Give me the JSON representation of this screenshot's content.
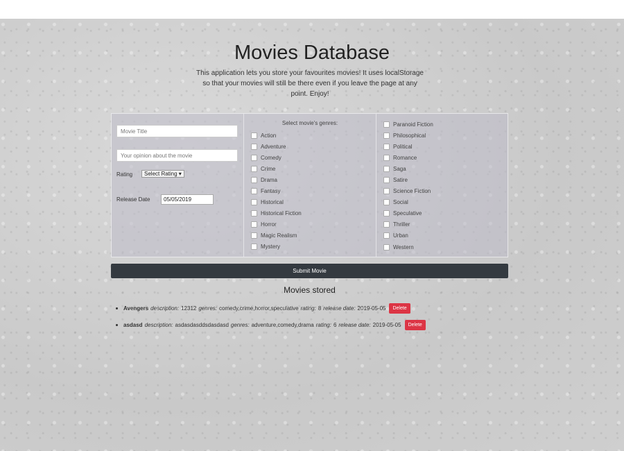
{
  "header": {
    "title": "Movies Database",
    "intro": "This application lets you store your favourites movies! It uses localStorage so that your movies will still be there even if you leave the page at any point. Enjoy!"
  },
  "form": {
    "title_placeholder": "Movie Title",
    "opinion_placeholder": "Your opinion about the movie",
    "rating_label": "Rating",
    "rating_select_value": "Select Rating ▾",
    "release_date_label": "Release Date",
    "release_date_value": "05/05/2019",
    "genres_heading": "Select movie's genres:",
    "genres_col1": [
      "Action",
      "Adventure",
      "Comedy",
      "Crime",
      "Drama",
      "Fantasy",
      "Historical",
      "Historical Fiction",
      "Horror",
      "Magic Realism",
      "Mystery"
    ],
    "genres_col2": [
      "Paranoid Fiction",
      "Philosophical",
      "Political",
      "Romance",
      "Saga",
      "Satire",
      "Science Fiction",
      "Social",
      "Speculative",
      "Thriller",
      "Urban",
      "Western"
    ],
    "submit_label": "Submit Movie"
  },
  "stored": {
    "title": "Movies stored",
    "description_label": "description:",
    "genres_label": "genres:",
    "rating_label": "rating:",
    "release_label": "release date:",
    "delete_label": "Delete",
    "movies": [
      {
        "name": "Avengers",
        "description": "12312",
        "genres": "comedy,crime,horror,speculative",
        "rating": "8",
        "release": "2019-05-05"
      },
      {
        "name": "asdasd",
        "description": "asdasdasddsdasdasd",
        "genres": "adventure,comedy,drama",
        "rating": "6",
        "release": "2019-05-05"
      }
    ]
  }
}
